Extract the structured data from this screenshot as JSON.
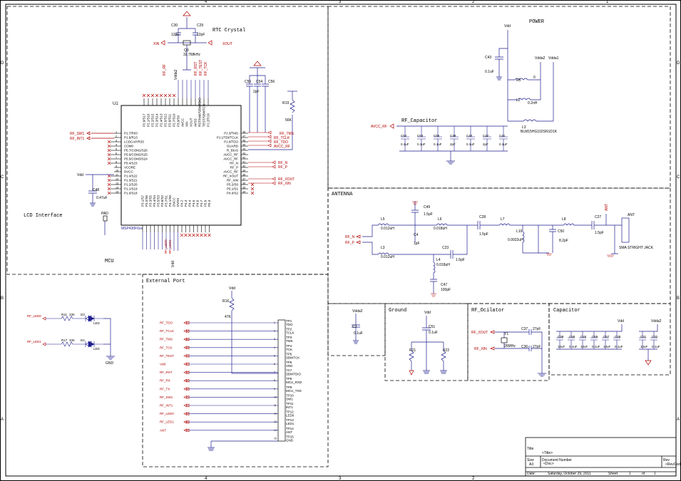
{
  "sections": {
    "rtc": "RTC Crystal",
    "power": "POWER",
    "rf_cap": "RF_Capacitor",
    "antenna": "ANTENNA",
    "lcd": "LCD Interface",
    "mcu": "MCU",
    "ext_port": "External Port",
    "ground": "Ground",
    "rf_osc": "RF_Ocilator",
    "capacitor": "Capacitor"
  },
  "mcu": {
    "ref": "U1",
    "part": "MSP430F6xx",
    "left_pins": [
      {
        "num": "1",
        "name": "P1.7/R03"
      },
      {
        "num": "2",
        "name": "P1.6/R13"
      },
      {
        "num": "3",
        "name": "LCDCAP/R33"
      },
      {
        "num": "4",
        "name": "COM0"
      },
      {
        "num": "5",
        "name": "P5.7/COM1/S26"
      },
      {
        "num": "6",
        "name": "P5.6/COM2/S25"
      },
      {
        "num": "7",
        "name": "P5.5/COM3/S24"
      },
      {
        "num": "8",
        "name": "P5.4/S23"
      },
      {
        "num": "9",
        "name": "VCORE"
      },
      {
        "num": "10",
        "name": "DVCC"
      },
      {
        "num": "11",
        "name": "P1.4/S22"
      },
      {
        "num": "12",
        "name": "P1.3/S21"
      },
      {
        "num": "13",
        "name": "P1.2/S20"
      },
      {
        "num": "14",
        "name": "P1.1/S19"
      },
      {
        "num": "15",
        "name": "P1.0/S18"
      }
    ],
    "right_pins": [
      {
        "num": "48",
        "name": "PJ.3/TMS"
      },
      {
        "num": "47",
        "name": "PJ.1/TDI/TCLK"
      },
      {
        "num": "46",
        "name": "PJ.0/TDO"
      },
      {
        "num": "45",
        "name": "GUARD"
      },
      {
        "num": "44",
        "name": "R_BIAS"
      },
      {
        "num": "43",
        "name": "AVCC_RF"
      },
      {
        "num": "42",
        "name": "AVCC_RF"
      },
      {
        "num": "41",
        "name": "RF_N"
      },
      {
        "num": "40",
        "name": "RF_P"
      },
      {
        "num": "39",
        "name": "AVCC_RF"
      },
      {
        "num": "38",
        "name": "RF_XOUT"
      },
      {
        "num": "37",
        "name": "RF_XIN"
      },
      {
        "num": "36",
        "name": "P5.2/S0"
      },
      {
        "num": "35",
        "name": "P5.1/S1"
      },
      {
        "num": "34",
        "name": "P4.0/S2"
      }
    ],
    "top_pins": [
      "P2.0/S17",
      "P2.1/S16",
      "P2.2/S15",
      "P2.3/S14",
      "P2.4/S13",
      "P2.5/S12",
      "P2.6/S11",
      "P2.7/S10",
      "P3.0/S9",
      "AVCC",
      "XIN",
      "XOUT",
      "AVSS",
      "RST/NMI/SBWTDIO",
      "TEST/SBWTCK",
      "PJ.2/TCK"
    ],
    "bottom_pins": [
      "P3.1/S7",
      "P3.2/S6",
      "P3.3/S5",
      "P3.4/S4",
      "P3.5/S3",
      "P3.6/S2",
      "P3.7/S1",
      "P4.1/S0",
      "DVCC",
      "DVSS",
      "P4.2",
      "P4.3",
      "P4.4",
      "P4.5",
      "P4.6",
      "P4.7",
      "P5.0",
      "P5.3"
    ],
    "left_nets": [
      "RF_SW1",
      "RF_INT1"
    ],
    "right_nets": [
      "RF_TMS",
      "RF_TCLK",
      "RF_TDO",
      "AVCC_RF",
      "RF_N",
      "RF_P",
      "RF_XOUT",
      "RF_XIN"
    ],
    "top_nets": [
      "RF_RF",
      "RF_RST",
      "RF_TEST",
      "RF_TCK"
    ],
    "vcore_cap": {
      "ref": "C48",
      "value": "0.47uF"
    },
    "vdd": "Vdd",
    "pad": "PAD",
    "bottom_vdd": "Vdd",
    "bottom_nets": [
      "RF_LED0",
      "RF_LED1"
    ]
  },
  "rtc": {
    "c30": {
      "ref": "C30",
      "value": "12pF"
    },
    "c29": {
      "ref": "C29",
      "value": "12pF"
    },
    "crystal": {
      "ref": "Q3",
      "value": "32.768kHz"
    },
    "xin": "XIN",
    "xout": "XOUT",
    "vdda2": "Vdda2"
  },
  "rbias": {
    "r19": {
      "ref": "R19",
      "value": "56K"
    },
    "caps": [
      {
        "ref": "C55",
        "value": ""
      },
      {
        "ref": "C54",
        "value": "2pF"
      },
      {
        "ref": "C56",
        "value": ""
      }
    ]
  },
  "power": {
    "vdd": "Vdd",
    "vdda2": "Vdda2",
    "vdda1": "Vdda1",
    "c43": {
      "ref": "C43",
      "value": "0.1uF"
    },
    "r5": {
      "ref": "R5",
      "value": "0"
    },
    "l2": {
      "ref": "L2",
      "value": "0.2nH"
    },
    "l3": {
      "ref": "L3",
      "value": "BLM15HG102SN1D1K"
    }
  },
  "rf_cap": {
    "net": "AVCC_RF",
    "caps": [
      {
        "ref": "C52",
        "value": "0.1uF"
      },
      {
        "ref": "C53",
        "value": "0.1uF"
      },
      {
        "ref": "C58",
        "value": "0.1uF"
      },
      {
        "ref": "C39",
        "value": "2pF"
      },
      {
        "ref": "C40",
        "value": "0.1uF"
      },
      {
        "ref": "C42",
        "value": "2pF"
      },
      {
        "ref": "C41",
        "value": "0.1uF"
      }
    ]
  },
  "antenna": {
    "rf_n": "RF_N",
    "rf_p": "RF_P",
    "l5": {
      "ref": "L5",
      "value": "0.012uH"
    },
    "l3": {
      "ref": "L3",
      "value": "0.012uH"
    },
    "c4": {
      "ref": "C4",
      "value": "1pF"
    },
    "c49": {
      "ref": "C49",
      "value": "1.5pF"
    },
    "l6": {
      "ref": "L6",
      "value": "0.018uH"
    },
    "c23": {
      "ref": "C23",
      "value": "1.5pF"
    },
    "l4": {
      "ref": "L4",
      "value": "0.018uH"
    },
    "c47": {
      "ref": "C47",
      "value": "100pF"
    },
    "c28": {
      "ref": "C28",
      "value": "1.5pF"
    },
    "l7": {
      "ref": "L7",
      "value": ""
    },
    "l10": {
      "ref": "L10",
      "value": "0.0022uH"
    },
    "c50": {
      "ref": "C50",
      "value": "8.2pF"
    },
    "l8": {
      "ref": "L8",
      "value": ""
    },
    "c27": {
      "ref": "C27",
      "value": "1.5pF"
    },
    "ant_net": "ANT",
    "ant": "ANT",
    "jack": "SMA STRIGHT JACK"
  },
  "led": [
    {
      "net": "RF_LED0",
      "r": "R11",
      "rv": "330",
      "d": "D3",
      "dv": "LED"
    },
    {
      "net": "RF_LED1",
      "r": "R17",
      "rv": "330",
      "d": "D4",
      "dv": "LED"
    }
  ],
  "led_gnd": "GND",
  "ext_port": {
    "vdd": "Vdd",
    "r16": {
      "ref": "R16",
      "value": "47K"
    },
    "rows": [
      {
        "net": "RF_TDO",
        "tp": "TP1",
        "name": "TDO"
      },
      {
        "net": "RF_TCLK",
        "tp": "TP2",
        "name": "TCLK"
      },
      {
        "net": "RF_TMS",
        "tp": "TP3",
        "name": "TMS"
      },
      {
        "net": "RF_TCK",
        "tp": "TP4",
        "name": "TCK"
      },
      {
        "net": "RF_TEST",
        "tp": "TP5",
        "name": "SBWTCK"
      },
      {
        "net": "Vdd",
        "tp": "TP6",
        "name": "VDD"
      },
      {
        "net": "RF_RST",
        "tp": "TP7",
        "name": "SBWTDIO"
      },
      {
        "net": "RF_RX",
        "tp": "TP8",
        "name": "MCU_RXD"
      },
      {
        "net": "RF_TX",
        "tp": "TP9",
        "name": "MCU_TXD"
      },
      {
        "net": "RF_SW1",
        "tp": "TP10",
        "name": "SW1"
      },
      {
        "net": "RF_INT1",
        "tp": "TP11",
        "name": "INT1"
      },
      {
        "net": "RF_LED0",
        "tp": "TP12",
        "name": "LED0"
      },
      {
        "net": "RF_LED1",
        "tp": "TP13",
        "name": "LED1"
      },
      {
        "net": "ANT",
        "tp": "TP14",
        "name": "ANT"
      },
      {
        "net": "",
        "tp": "TP15",
        "name": "GND"
      }
    ]
  },
  "c3": {
    "ref": "C3",
    "value": "0.1uF",
    "net": "Vdda2"
  },
  "ground": {
    "vdd": "Vdd",
    "c51": {
      "ref": "C51",
      "value": "0.1uF"
    },
    "r21": "R21",
    "r22": "R22"
  },
  "rf_osc": {
    "xout": "RF_XOUT",
    "xin": "RF_XIN",
    "y1": {
      "ref": "Y1",
      "value": "26MHz"
    },
    "c37": {
      "ref": "C37",
      "value": "27pF"
    },
    "c36": {
      "ref": "C36",
      "value": "27pF"
    }
  },
  "capacitor": {
    "vdd": "Vdd",
    "vdda2": "Vdda2",
    "caps": [
      {
        "ref": "C39",
        "value": "10uF"
      },
      {
        "ref": "C48",
        "value": "0.1uF"
      },
      {
        "ref": "C45",
        "value": "10uF"
      },
      {
        "ref": "C59",
        "value": "0.1uF"
      },
      {
        "ref": "C57",
        "value": "10uF"
      },
      {
        "ref": "C38",
        "value": "0.1uF"
      }
    ],
    "caps2": [
      {
        "ref": "C31",
        "value": "10uF"
      },
      {
        "ref": "C32",
        "value": "0.1uF"
      }
    ]
  },
  "title_block": {
    "title_label": "Title",
    "title": "<Title>",
    "size_label": "Size",
    "size": "A3",
    "docnum_label": "Document Number",
    "docnum": "<Doc>",
    "rev_label": "Rev",
    "rev": "<RevCod",
    "date_label": "Date:",
    "date": "Saturday, October 29, 2011",
    "sheet_label": "Sheet",
    "sheet": "1",
    "of_label": "of",
    "of": "1"
  },
  "border": {
    "cols": [
      "4",
      "3",
      "2",
      "1"
    ],
    "rows": [
      "D",
      "C",
      "B",
      "A"
    ]
  },
  "colors": {
    "wire": "#1f1f8f",
    "net": "#b00000",
    "part": "#000000",
    "frame": "#000000"
  }
}
